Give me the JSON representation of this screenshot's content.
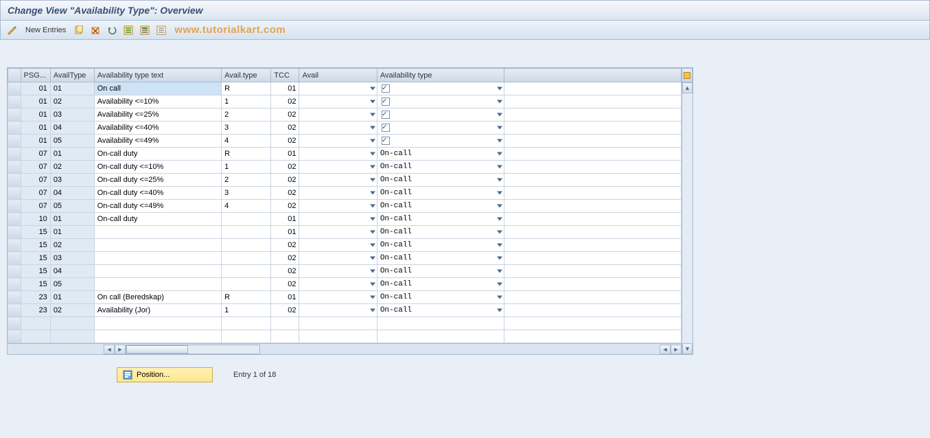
{
  "title": "Change View \"Availability Type\": Overview",
  "toolbar": {
    "new_entries": "New Entries"
  },
  "watermark": "www.tutorialkart.com",
  "columns": {
    "psg": "PSG...",
    "atype": "AvailType",
    "atext": "Availability type text",
    "avtype": "Avail.type",
    "tcc": "TCC",
    "avail": "Avail",
    "atype2": "Availability type"
  },
  "rows": [
    {
      "psg": "01",
      "atype": "01",
      "atext": "On call",
      "avtype": "R",
      "tcc": "01",
      "avail": "",
      "check": true,
      "atype2": ""
    },
    {
      "psg": "01",
      "atype": "02",
      "atext": "Availability <=10%",
      "avtype": "1",
      "tcc": "02",
      "avail": "",
      "check": true,
      "atype2": ""
    },
    {
      "psg": "01",
      "atype": "03",
      "atext": "Availability <=25%",
      "avtype": "2",
      "tcc": "02",
      "avail": "",
      "check": true,
      "atype2": ""
    },
    {
      "psg": "01",
      "atype": "04",
      "atext": "Availability <=40%",
      "avtype": "3",
      "tcc": "02",
      "avail": "",
      "check": true,
      "atype2": ""
    },
    {
      "psg": "01",
      "atype": "05",
      "atext": "Availability <=49%",
      "avtype": "4",
      "tcc": "02",
      "avail": "",
      "check": true,
      "atype2": ""
    },
    {
      "psg": "07",
      "atype": "01",
      "atext": "On-call duty",
      "avtype": "R",
      "tcc": "01",
      "avail": "",
      "check": false,
      "atype2": "On-call"
    },
    {
      "psg": "07",
      "atype": "02",
      "atext": "On-call duty <=10%",
      "avtype": "1",
      "tcc": "02",
      "avail": "",
      "check": false,
      "atype2": "On-call"
    },
    {
      "psg": "07",
      "atype": "03",
      "atext": "On-call duty <=25%",
      "avtype": "2",
      "tcc": "02",
      "avail": "",
      "check": false,
      "atype2": "On-call"
    },
    {
      "psg": "07",
      "atype": "04",
      "atext": "On-call duty <=40%",
      "avtype": "3",
      "tcc": "02",
      "avail": "",
      "check": false,
      "atype2": "On-call"
    },
    {
      "psg": "07",
      "atype": "05",
      "atext": "On-call duty <=49%",
      "avtype": "4",
      "tcc": "02",
      "avail": "",
      "check": false,
      "atype2": "On-call"
    },
    {
      "psg": "10",
      "atype": "01",
      "atext": "On-call duty",
      "avtype": "",
      "tcc": "01",
      "avail": "",
      "check": false,
      "atype2": "On-call"
    },
    {
      "psg": "15",
      "atype": "01",
      "atext": "",
      "avtype": "",
      "tcc": "01",
      "avail": "",
      "check": false,
      "atype2": "On-call"
    },
    {
      "psg": "15",
      "atype": "02",
      "atext": "",
      "avtype": "",
      "tcc": "02",
      "avail": "",
      "check": false,
      "atype2": "On-call"
    },
    {
      "psg": "15",
      "atype": "03",
      "atext": "",
      "avtype": "",
      "tcc": "02",
      "avail": "",
      "check": false,
      "atype2": "On-call"
    },
    {
      "psg": "15",
      "atype": "04",
      "atext": "",
      "avtype": "",
      "tcc": "02",
      "avail": "",
      "check": false,
      "atype2": "On-call"
    },
    {
      "psg": "15",
      "atype": "05",
      "atext": "",
      "avtype": "",
      "tcc": "02",
      "avail": "",
      "check": false,
      "atype2": "On-call"
    },
    {
      "psg": "23",
      "atype": "01",
      "atext": "On call (Beredskap)",
      "avtype": "R",
      "tcc": "01",
      "avail": "",
      "check": false,
      "atype2": "On-call"
    },
    {
      "psg": "23",
      "atype": "02",
      "atext": "Availability (Jor)",
      "avtype": "1",
      "tcc": "02",
      "avail": "",
      "check": false,
      "atype2": "On-call"
    }
  ],
  "footer": {
    "position_label": "Position...",
    "entry_text": "Entry 1 of 18"
  }
}
